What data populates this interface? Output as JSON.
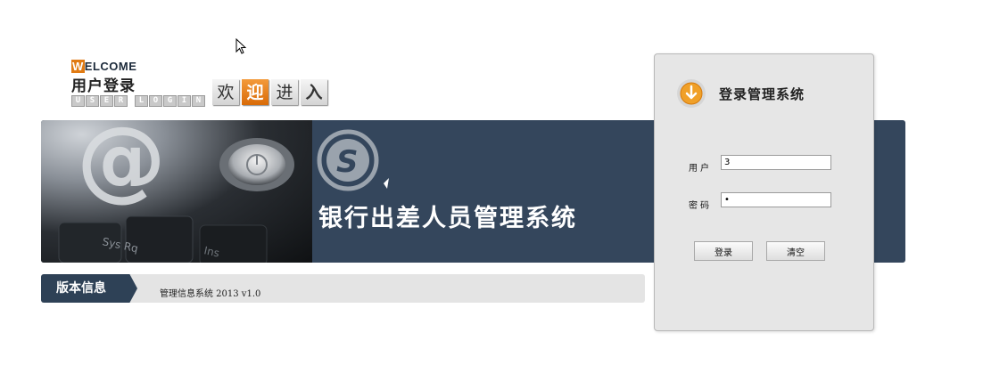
{
  "header": {
    "welcome_first": "W",
    "welcome_rest": "ELCOME",
    "login_cn": "用户登录",
    "login_en_letters": [
      "U",
      "S",
      "E",
      "R",
      "",
      "L",
      "O",
      "G",
      "I",
      "N"
    ],
    "welcome_enter": [
      "欢",
      "迎",
      "进",
      "入"
    ]
  },
  "banner": {
    "title": "银行出差人员管理系统"
  },
  "version": {
    "tab_label": "版本信息",
    "text": "管理信息系统 2013 v1.0"
  },
  "login": {
    "title": "登录管理系统",
    "username_label": "用户",
    "password_label": "密码",
    "username_value": "3",
    "password_value": "•",
    "login_button": "登录",
    "clear_button": "清空"
  },
  "colors": {
    "banner_bg": "#34465c",
    "accent_orange": "#e07b14",
    "panel_bg": "#e6e6e6"
  },
  "icons": {
    "cursor": "cursor-arrow-icon",
    "login": "download-arrow-icon",
    "banner_logo": "s-circle-logo"
  }
}
